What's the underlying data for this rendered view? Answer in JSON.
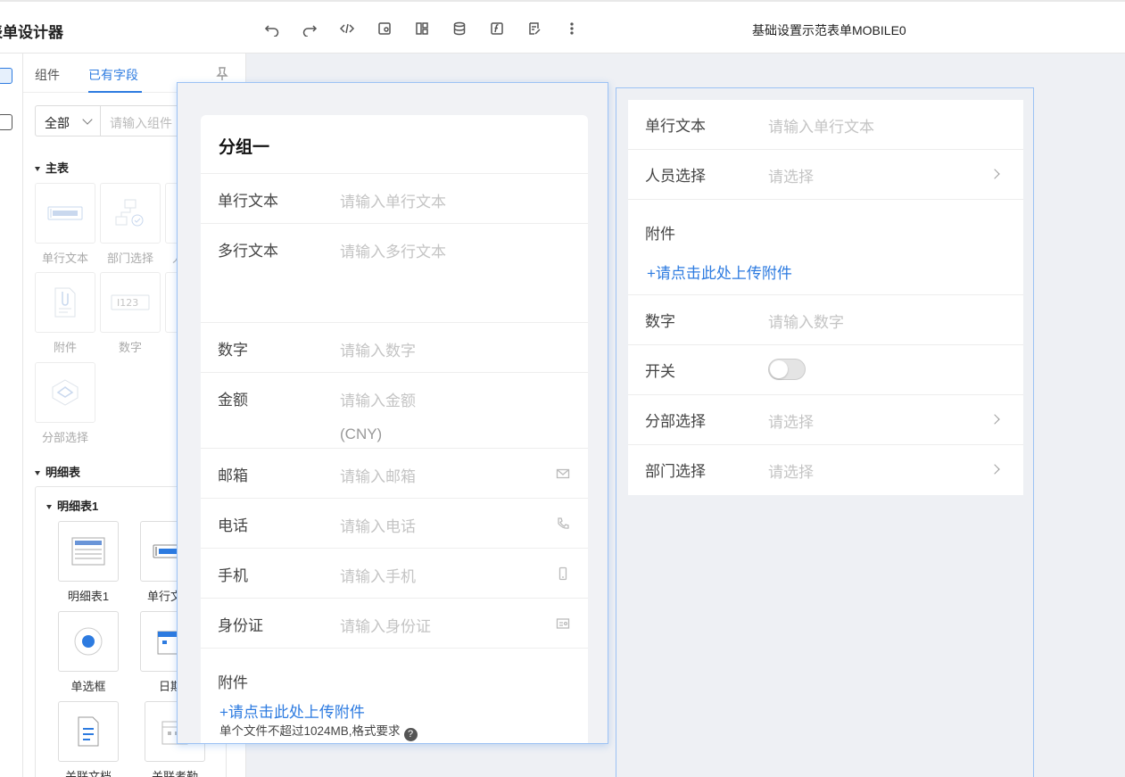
{
  "app": {
    "title": "表单设计器",
    "form_name": "基础设置示范表单MOBILE0"
  },
  "toolbar": [
    {
      "icon": "undo-icon"
    },
    {
      "icon": "redo-icon"
    },
    {
      "icon": "code-icon"
    },
    {
      "icon": "preview-settings-icon"
    },
    {
      "icon": "layout-icon"
    },
    {
      "icon": "database-icon"
    },
    {
      "icon": "function-icon"
    },
    {
      "icon": "edit-note-icon"
    },
    {
      "icon": "more-icon"
    }
  ],
  "panel": {
    "tabs": [
      "组件",
      "已有字段"
    ],
    "active_tab": "已有字段",
    "filter_value": "全部",
    "search_placeholder": "请输入组件",
    "main_group": "主表",
    "main_items": [
      "单行文本",
      "部门选择",
      "人员选择",
      "附件",
      "数字",
      "分部选择"
    ],
    "detail_group": "明细表",
    "detail_sub": "明细表1",
    "detail_items": [
      "明细表1",
      "单行文本",
      "单选框",
      "日期",
      "关联文档",
      "关联考勤"
    ]
  },
  "middle": {
    "group_title": "分组一",
    "fields": [
      {
        "label": "单行文本",
        "placeholder": "请输入单行文本"
      },
      {
        "label": "多行文本",
        "placeholder": "请输入多行文本"
      },
      {
        "label": "数字",
        "placeholder": "请输入数字"
      },
      {
        "label": "金额",
        "placeholder": "请输入金额",
        "unit": "(CNY)"
      },
      {
        "label": "邮箱",
        "placeholder": "请输入邮箱",
        "icon": "mail-icon"
      },
      {
        "label": "电话",
        "placeholder": "请输入电话",
        "icon": "phone-icon"
      },
      {
        "label": "手机",
        "placeholder": "请输入手机",
        "icon": "mobile-icon"
      },
      {
        "label": "身份证",
        "placeholder": "请输入身份证",
        "icon": "id-card-icon"
      },
      {
        "label": "附件"
      }
    ],
    "upload_link": "+请点击此处上传附件",
    "upload_note": "单个文件不超过1024MB,格式要求",
    "help": "?"
  },
  "right": {
    "rows": [
      {
        "label": "单行文本",
        "placeholder": "请输入单行文本"
      },
      {
        "label": "人员选择",
        "placeholder": "请选择",
        "chevron": true
      },
      {
        "label": "附件",
        "upload": "+请点击此处上传附件"
      },
      {
        "label": "数字",
        "placeholder": "请输入数字"
      },
      {
        "label": "开关",
        "switch": false
      },
      {
        "label": "分部选择",
        "placeholder": "请选择",
        "chevron": true
      },
      {
        "label": "部门选择",
        "placeholder": "请选择",
        "chevron": true
      }
    ]
  },
  "colors": {
    "accent": "#2d7be0",
    "canvas": "#eef0f4"
  }
}
